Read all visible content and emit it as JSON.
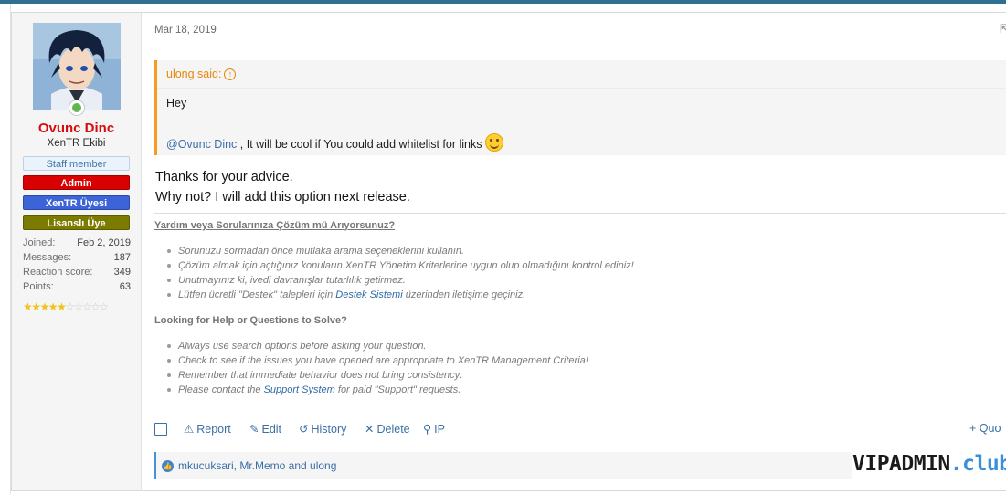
{
  "user": {
    "name": "Ovunc Dinc",
    "title": "XenTR Ekibi",
    "banners": {
      "staff": "Staff member",
      "admin": "Admin",
      "member": "XenTR Üyesi",
      "licensed": "Lisanslı Üye"
    },
    "stats": [
      {
        "label": "Joined:",
        "value": "Feb 2, 2019"
      },
      {
        "label": "Messages:",
        "value": "187"
      },
      {
        "label": "Reaction score:",
        "value": "349"
      },
      {
        "label": "Points:",
        "value": "63"
      }
    ],
    "rating_stars": 4.5,
    "rating_max": 10,
    "online_status": "online"
  },
  "post": {
    "date": "Mar 18, 2019",
    "quote": {
      "author": "ulong said:",
      "line1": "Hey",
      "mention": "@Ovunc Dinc",
      "line2": " , It will be cool if You could add whitelist for links"
    },
    "reply_lines": [
      "Thanks for your advice.",
      "Why not? I will add this option next release."
    ]
  },
  "signature": {
    "tr_heading": "Yardım veya Sorularınıza Çözüm mü Arıyorsunuz?",
    "tr_items": [
      "Sorunuzu sormadan önce mutlaka arama seçeneklerini kullanın.",
      "Çözüm almak için açtığınız konuların XenTR Yönetim Kriterlerine uygun olup olmadığını kontrol ediniz!",
      "Unutmayınız ki, ivedi davranışlar tutarlılık getirmez."
    ],
    "tr_last_pre": "Lütfen ücretli \"Destek\" talepleri için ",
    "tr_last_link": "Destek Sistemi",
    "tr_last_post": " üzerinden iletişime geçiniz.",
    "en_heading": "Looking for Help or Questions to Solve?",
    "en_items": [
      "Always use search options before asking your question.",
      "Check to see if the issues you have opened are appropriate to XenTR Management Criteria!",
      "Remember that immediate behavior does not bring consistency."
    ],
    "en_last_pre": "Please contact the ",
    "en_last_link": "Support System",
    "en_last_post": " for paid \"Support\" requests."
  },
  "actions": {
    "report": "Report",
    "edit": "Edit",
    "history": "History",
    "delete": "Delete",
    "ip": "IP",
    "quote": "+ Quo"
  },
  "reactions": {
    "names": "mkucuksari, Mr.Memo and ulong"
  },
  "watermark": {
    "main": "VIPADMIN",
    "suffix": ".club"
  },
  "colors": {
    "username": "#d70b0b",
    "quote_accent": "#f59a23",
    "link": "#3b6fa5",
    "admin_banner": "#d90000",
    "member_banner": "#3d63d8",
    "licensed_banner": "#7b7b00",
    "online": "#63b64f"
  }
}
